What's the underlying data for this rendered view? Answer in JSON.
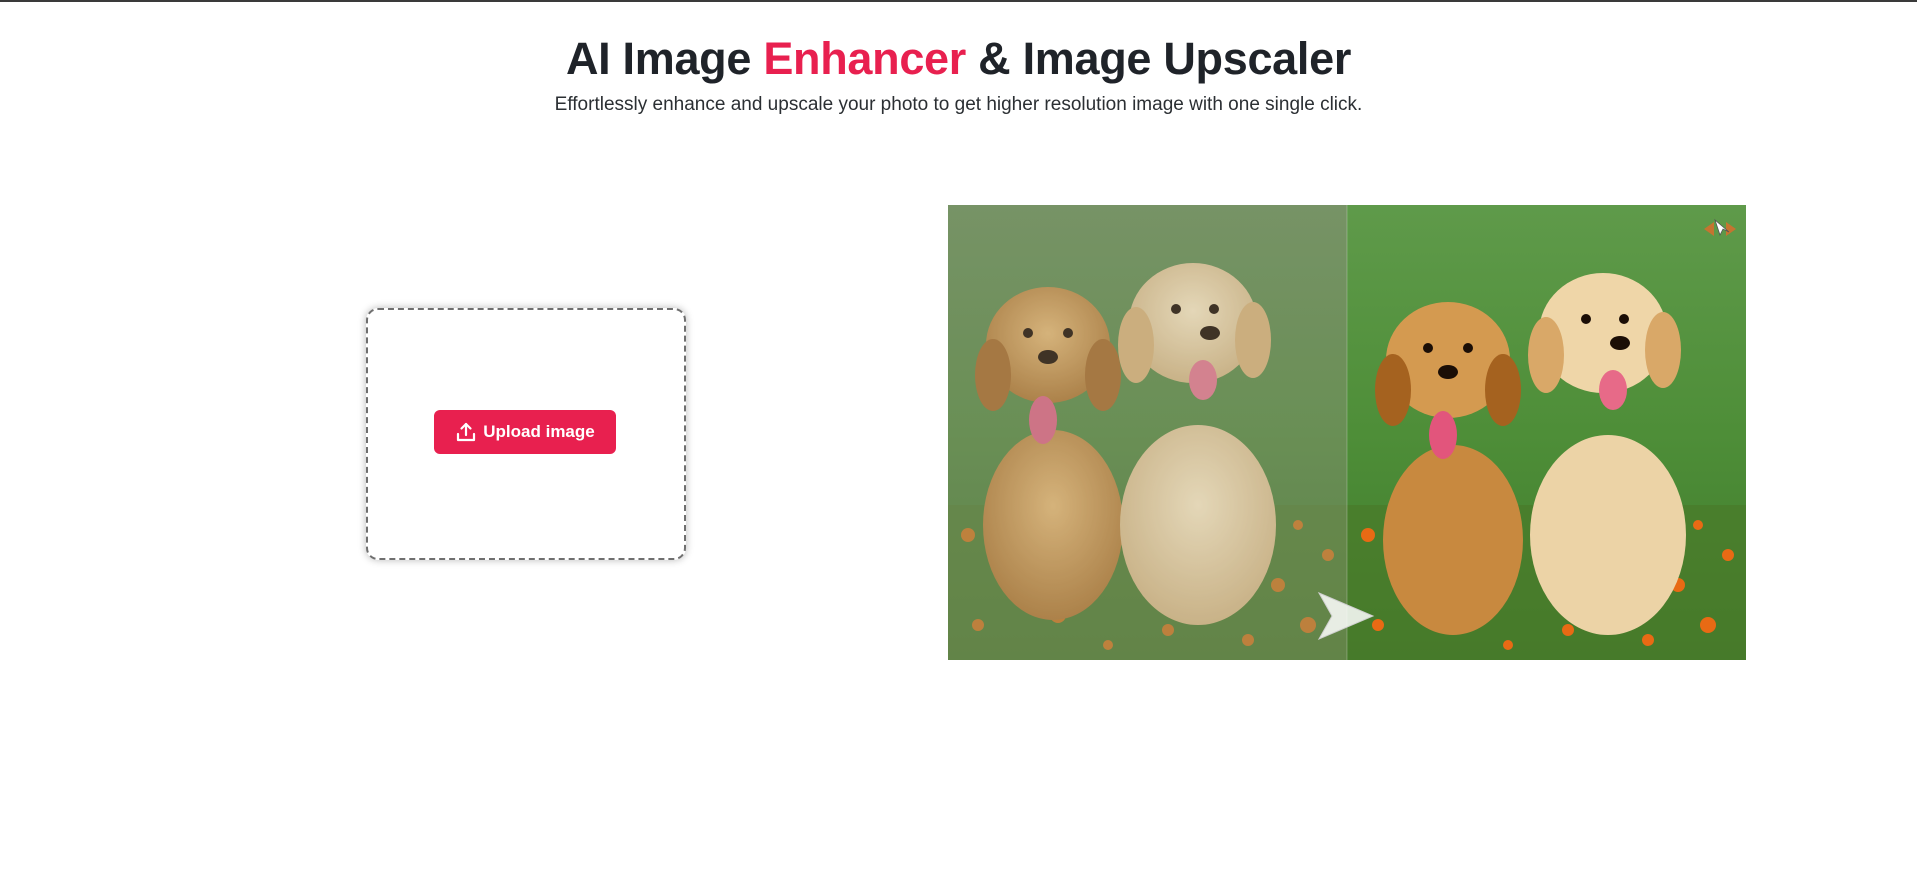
{
  "header": {
    "title_part1": "AI Image ",
    "title_accent": "Enhancer",
    "title_part2": " & Image Upscaler",
    "subtitle": "Effortlessly enhance and upscale your photo to get higher resolution image with one single click."
  },
  "upload": {
    "button_label": "Upload image",
    "icon": "upload-icon"
  },
  "comparison": {
    "image_subject": "two golden retriever puppies sitting in grass with orange flowers",
    "icons": [
      "arrow-right-icon",
      "drag-handle-icon"
    ]
  },
  "colors": {
    "accent": "#e8204f",
    "text": "#1f2329",
    "border": "#6f6f6f"
  }
}
